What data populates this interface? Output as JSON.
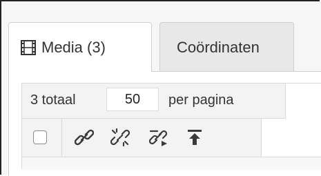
{
  "tabs": [
    {
      "label": "Media (3)",
      "icon": "film-icon",
      "active": true
    },
    {
      "label": "Coördinaten",
      "active": false
    }
  ],
  "pagination": {
    "total_label": "3 totaal",
    "per_page_value": "50",
    "per_page_label": "per pagina"
  },
  "toolbar": {
    "icons": [
      "link-icon",
      "unlink-icon",
      "edit-link-icon",
      "upload-top-icon"
    ]
  },
  "colors": {
    "active_tab_bg": "#ffffff",
    "inactive_tab_bg": "#e8e8e8",
    "border": "#cfcfcf"
  }
}
